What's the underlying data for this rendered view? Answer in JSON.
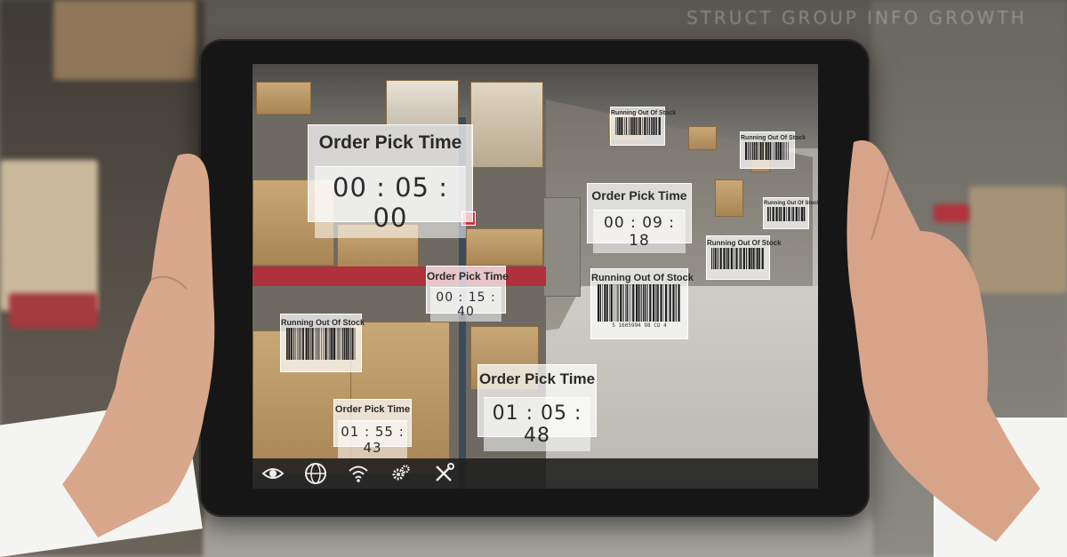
{
  "background": {
    "overlay_text": "STRUCT GROUP INFO GROWTH"
  },
  "cards": [
    {
      "kind": "timer",
      "title": "Order Pick Time",
      "value": "00 : 05 : 00"
    },
    {
      "kind": "barcode",
      "title": "Running Out Of Stock"
    },
    {
      "kind": "barcode",
      "title": "Running Out Of Stock"
    },
    {
      "kind": "timer",
      "title": "Order Pick Time",
      "value": "00 : 09 : 18"
    },
    {
      "kind": "barcode",
      "title": "Running Out Of Stock"
    },
    {
      "kind": "barcode",
      "title": "Running Out Of Stock"
    },
    {
      "kind": "timer",
      "title": "Order Pick Time",
      "value": "00 : 15 : 40"
    },
    {
      "kind": "barcode",
      "title": "Running Out Of Stock",
      "code": "5 1605994 98 CO 4"
    },
    {
      "kind": "barcode",
      "title": "Running Out Of Stock"
    },
    {
      "kind": "timer",
      "title": "Order Pick Time",
      "value": "01 : 05 : 48"
    },
    {
      "kind": "timer",
      "title": "Order Pick Time",
      "value": "01 : 55 : 43"
    }
  ],
  "toolbar": {
    "icons": [
      "eye-icon",
      "globe-icon",
      "wifi-icon",
      "gears-icon",
      "tools-icon"
    ]
  },
  "colors": {
    "accent_red": "#d2323c",
    "card_bg": "#ffffffb8",
    "toolbar_bg": "#1e1e1e"
  }
}
